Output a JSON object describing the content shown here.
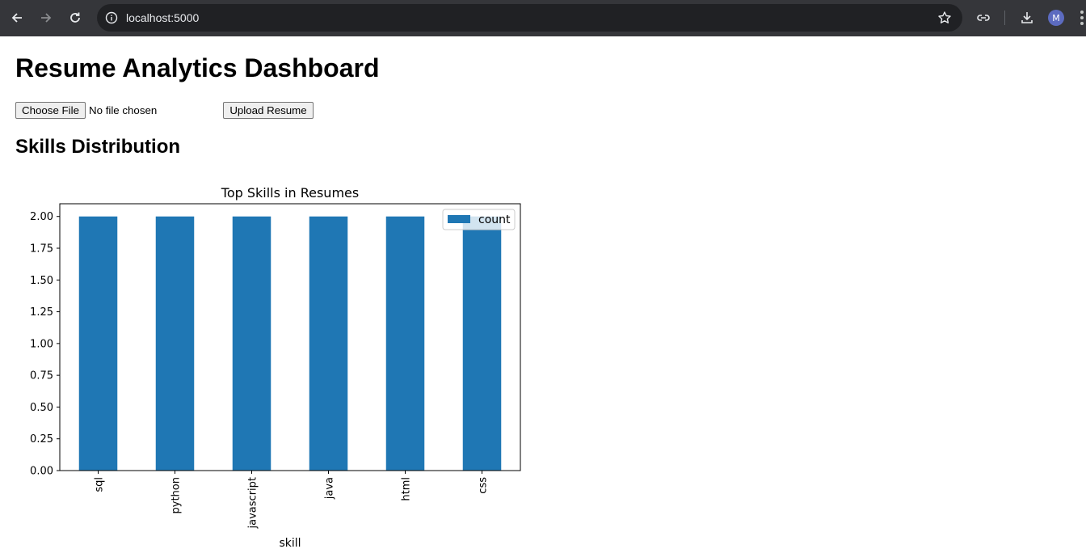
{
  "browser": {
    "url": "localhost:5000",
    "profile_initial": "M"
  },
  "page": {
    "title": "Resume Analytics Dashboard",
    "file_input": {
      "button_label": "Choose File",
      "status_text": "No file chosen"
    },
    "upload_button_label": "Upload Resume",
    "section_title": "Skills Distribution"
  },
  "colors": {
    "bar": "#1f77b4"
  },
  "chart_data": {
    "type": "bar",
    "title": "Top Skills in Resumes",
    "xlabel": "skill",
    "ylabel": "",
    "categories": [
      "sql",
      "python",
      "javascript",
      "java",
      "html",
      "css"
    ],
    "series": [
      {
        "name": "count",
        "values": [
          2,
          2,
          2,
          2,
          2,
          2
        ]
      }
    ],
    "ylim": [
      0,
      2.1
    ],
    "yticks": [
      "0.00",
      "0.25",
      "0.50",
      "0.75",
      "1.00",
      "1.25",
      "1.50",
      "1.75",
      "2.00"
    ],
    "ytick_values": [
      0,
      0.25,
      0.5,
      0.75,
      1.0,
      1.25,
      1.5,
      1.75,
      2.0
    ],
    "legend_position": "top-right",
    "grid": false
  }
}
